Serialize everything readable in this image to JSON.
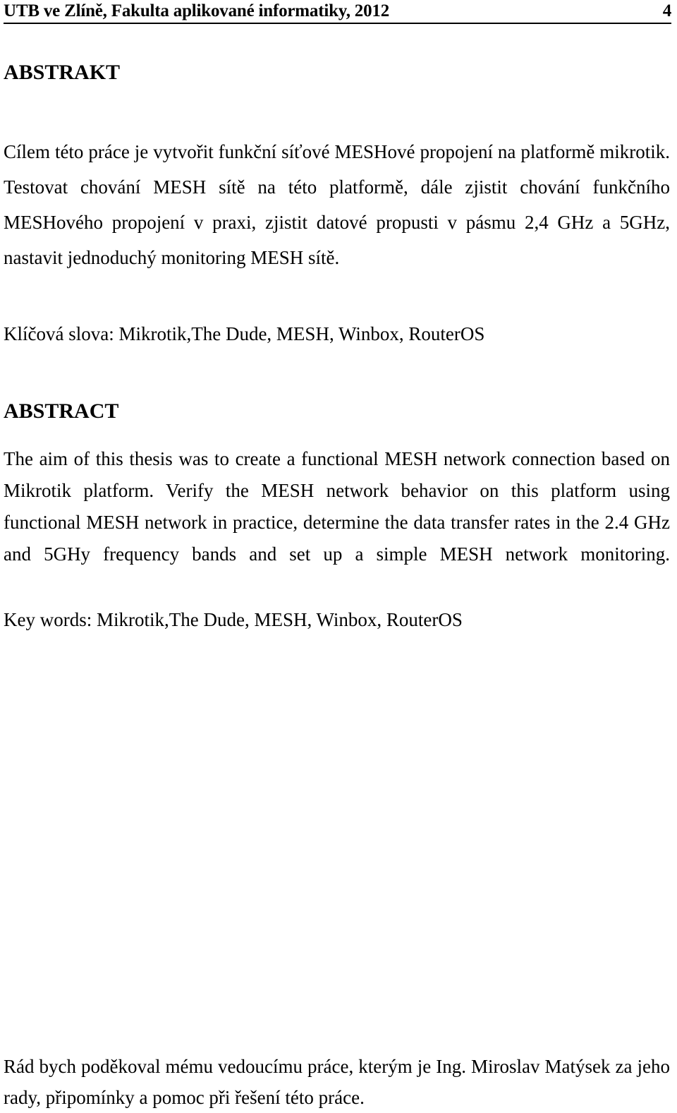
{
  "header": {
    "title": "UTB ve Zlíně, Fakulta aplikované informatiky, 2012",
    "page_number": "4"
  },
  "sections": {
    "abstrakt": {
      "heading": "ABSTRAKT",
      "body": "Cílem této práce je vytvořit funkční síťové  MESHové propojení na platformě mikrotik. Testovat chování MESH sítě na této platformě, dále zjistit chování funkčního MESHového propojení v praxi, zjistit datové propusti v pásmu 2,4 GHz a 5GHz, nastavit jednoduchý monitoring MESH sítě.",
      "keywords": "Klíčová slova: Mikrotik,The Dude, MESH, Winbox, RouterOS"
    },
    "abstract": {
      "heading": "ABSTRACT",
      "body": "The aim of this thesis was to create a functional MESH network connection based on Mikrotik platform. Verify the MESH network behavior on this platform using functional MESH network in practice, determine the data transfer rates in the 2.4 GHz and 5GHy frequency bands and set up a simple MESH network monitoring.",
      "keywords": "Key words: Mikrotik,The Dude, MESH, Winbox, RouterOS"
    }
  },
  "acknowledgement": {
    "text": "Rád bych poděkoval mému vedoucímu práce, kterým je Ing. Miroslav Matýsek za jeho rady, připomínky a pomoc při řešení této práce."
  },
  "colors": {
    "text": "#000000",
    "background": "#ffffff",
    "rule": "#000000"
  }
}
